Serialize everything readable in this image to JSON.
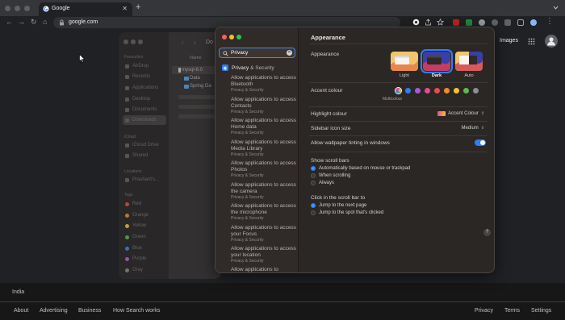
{
  "browser": {
    "tab_title": "Google",
    "tab_close": "✕",
    "new_tab": "+",
    "url": "google.com"
  },
  "google": {
    "images_link": "Images",
    "location": "India",
    "footer_left": [
      "About",
      "Advertising",
      "Business",
      "How Search works"
    ],
    "footer_right": [
      "Privacy",
      "Terms",
      "Settings"
    ]
  },
  "finder": {
    "toolbar_title": "Do",
    "column_name": "Name",
    "files": [
      "mysql-8.0",
      "Data",
      "Spring Da"
    ],
    "sidebar": {
      "favourites_head": "Favourites",
      "favourites": [
        "AirDrop",
        "Recents",
        "Applications",
        "Desktop",
        "Documents",
        "Downloads"
      ],
      "icloud_head": "iCloud",
      "icloud": [
        "iCloud Drive",
        "Shared"
      ],
      "locations_head": "Locations",
      "locations": [
        "Prashant's..."
      ],
      "tags_head": "Tags",
      "tags": [
        {
          "label": "Red",
          "color": "#e5544b"
        },
        {
          "label": "Orange",
          "color": "#f0953a"
        },
        {
          "label": "Yellow",
          "color": "#f2c94c"
        },
        {
          "label": "Green",
          "color": "#5ac05a"
        },
        {
          "label": "Blue",
          "color": "#3b8cf0"
        },
        {
          "label": "Purple",
          "color": "#b06ad9"
        },
        {
          "label": "Gray",
          "color": "#8e8e93"
        }
      ]
    }
  },
  "settings": {
    "search_query": "Privacy",
    "search_clear": "✕",
    "header_highlight": "Privacy",
    "header_rest": "& Security",
    "results": [
      {
        "title": "Allow applications to access Bluetooth",
        "sub": "Privacy & Security"
      },
      {
        "title": "Allow applications to access Contacts",
        "sub": "Privacy & Security"
      },
      {
        "title": "Allow applications to access Home data",
        "sub": "Privacy & Security"
      },
      {
        "title": "Allow applications to access Media Library",
        "sub": "Privacy & Security"
      },
      {
        "title": "Allow applications to access Photos",
        "sub": "Privacy & Security"
      },
      {
        "title": "Allow applications to access the camera",
        "sub": "Privacy & Security"
      },
      {
        "title": "Allow applications to access the microphone",
        "sub": "Privacy & Security"
      },
      {
        "title": "Allow applications to access your Focus",
        "sub": "Privacy & Security"
      },
      {
        "title": "Allow applications to access your location",
        "sub": "Privacy & Security"
      },
      {
        "title": "Allow applications to",
        "sub": ""
      }
    ],
    "pane_title": "Appearance",
    "appearance_label": "Appearance",
    "themes": [
      {
        "label": "Light",
        "selected": false
      },
      {
        "label": "Dark",
        "selected": true
      },
      {
        "label": "Auto",
        "selected": false
      }
    ],
    "accent_label": "Accent colour",
    "accent_colors": [
      "#c8c8c8",
      "#2f7ef5",
      "#a95ad6",
      "#e84a8e",
      "#ea4c4c",
      "#f08a2f",
      "#f2c233",
      "#5abc4e",
      "#8e8e8e"
    ],
    "accent_caption": "Multicolour",
    "highlight_label": "Highlight colour",
    "highlight_value": "Accent Colour",
    "sidebar_icon_label": "Sidebar icon size",
    "sidebar_icon_value": "Medium",
    "wallpaper_tint_label": "Allow wallpaper tinting in windows",
    "wallpaper_tint_on": true,
    "scrollbars_label": "Show scroll bars",
    "scrollbar_options": [
      "Automatically based on mouse or trackpad",
      "When scrolling",
      "Always"
    ],
    "scrollbar_selected": 0,
    "click_label": "Click in the scroll bar to",
    "click_options": [
      "Jump to the next page",
      "Jump to the spot that's clicked"
    ],
    "click_selected": 0,
    "help": "?"
  },
  "colors": {
    "accent_blue": "#2f7ef5",
    "search_focus": "#4a88d4"
  }
}
